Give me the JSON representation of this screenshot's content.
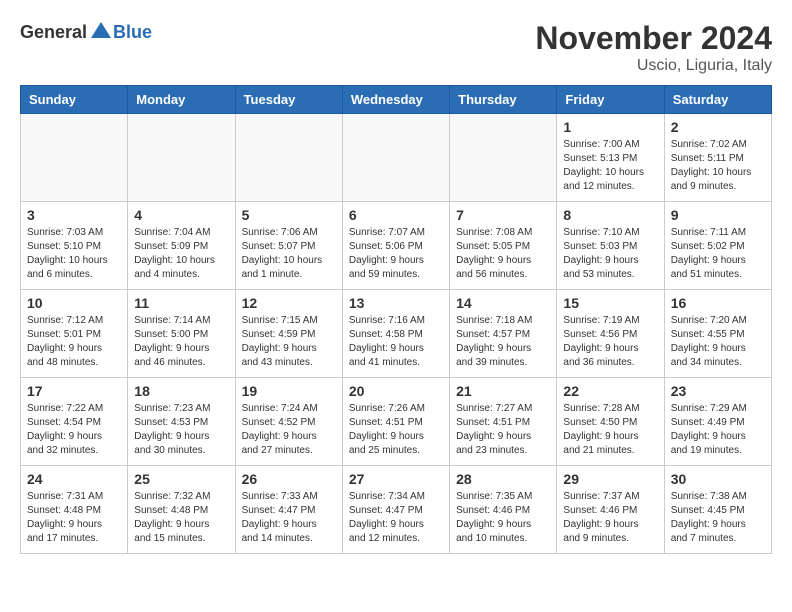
{
  "header": {
    "logo_general": "General",
    "logo_blue": "Blue",
    "month_year": "November 2024",
    "location": "Uscio, Liguria, Italy"
  },
  "weekdays": [
    "Sunday",
    "Monday",
    "Tuesday",
    "Wednesday",
    "Thursday",
    "Friday",
    "Saturday"
  ],
  "weeks": [
    [
      {
        "day": "",
        "info": ""
      },
      {
        "day": "",
        "info": ""
      },
      {
        "day": "",
        "info": ""
      },
      {
        "day": "",
        "info": ""
      },
      {
        "day": "",
        "info": ""
      },
      {
        "day": "1",
        "info": "Sunrise: 7:00 AM\nSunset: 5:13 PM\nDaylight: 10 hours\nand 12 minutes."
      },
      {
        "day": "2",
        "info": "Sunrise: 7:02 AM\nSunset: 5:11 PM\nDaylight: 10 hours\nand 9 minutes."
      }
    ],
    [
      {
        "day": "3",
        "info": "Sunrise: 7:03 AM\nSunset: 5:10 PM\nDaylight: 10 hours\nand 6 minutes."
      },
      {
        "day": "4",
        "info": "Sunrise: 7:04 AM\nSunset: 5:09 PM\nDaylight: 10 hours\nand 4 minutes."
      },
      {
        "day": "5",
        "info": "Sunrise: 7:06 AM\nSunset: 5:07 PM\nDaylight: 10 hours\nand 1 minute."
      },
      {
        "day": "6",
        "info": "Sunrise: 7:07 AM\nSunset: 5:06 PM\nDaylight: 9 hours\nand 59 minutes."
      },
      {
        "day": "7",
        "info": "Sunrise: 7:08 AM\nSunset: 5:05 PM\nDaylight: 9 hours\nand 56 minutes."
      },
      {
        "day": "8",
        "info": "Sunrise: 7:10 AM\nSunset: 5:03 PM\nDaylight: 9 hours\nand 53 minutes."
      },
      {
        "day": "9",
        "info": "Sunrise: 7:11 AM\nSunset: 5:02 PM\nDaylight: 9 hours\nand 51 minutes."
      }
    ],
    [
      {
        "day": "10",
        "info": "Sunrise: 7:12 AM\nSunset: 5:01 PM\nDaylight: 9 hours\nand 48 minutes."
      },
      {
        "day": "11",
        "info": "Sunrise: 7:14 AM\nSunset: 5:00 PM\nDaylight: 9 hours\nand 46 minutes."
      },
      {
        "day": "12",
        "info": "Sunrise: 7:15 AM\nSunset: 4:59 PM\nDaylight: 9 hours\nand 43 minutes."
      },
      {
        "day": "13",
        "info": "Sunrise: 7:16 AM\nSunset: 4:58 PM\nDaylight: 9 hours\nand 41 minutes."
      },
      {
        "day": "14",
        "info": "Sunrise: 7:18 AM\nSunset: 4:57 PM\nDaylight: 9 hours\nand 39 minutes."
      },
      {
        "day": "15",
        "info": "Sunrise: 7:19 AM\nSunset: 4:56 PM\nDaylight: 9 hours\nand 36 minutes."
      },
      {
        "day": "16",
        "info": "Sunrise: 7:20 AM\nSunset: 4:55 PM\nDaylight: 9 hours\nand 34 minutes."
      }
    ],
    [
      {
        "day": "17",
        "info": "Sunrise: 7:22 AM\nSunset: 4:54 PM\nDaylight: 9 hours\nand 32 minutes."
      },
      {
        "day": "18",
        "info": "Sunrise: 7:23 AM\nSunset: 4:53 PM\nDaylight: 9 hours\nand 30 minutes."
      },
      {
        "day": "19",
        "info": "Sunrise: 7:24 AM\nSunset: 4:52 PM\nDaylight: 9 hours\nand 27 minutes."
      },
      {
        "day": "20",
        "info": "Sunrise: 7:26 AM\nSunset: 4:51 PM\nDaylight: 9 hours\nand 25 minutes."
      },
      {
        "day": "21",
        "info": "Sunrise: 7:27 AM\nSunset: 4:51 PM\nDaylight: 9 hours\nand 23 minutes."
      },
      {
        "day": "22",
        "info": "Sunrise: 7:28 AM\nSunset: 4:50 PM\nDaylight: 9 hours\nand 21 minutes."
      },
      {
        "day": "23",
        "info": "Sunrise: 7:29 AM\nSunset: 4:49 PM\nDaylight: 9 hours\nand 19 minutes."
      }
    ],
    [
      {
        "day": "24",
        "info": "Sunrise: 7:31 AM\nSunset: 4:48 PM\nDaylight: 9 hours\nand 17 minutes."
      },
      {
        "day": "25",
        "info": "Sunrise: 7:32 AM\nSunset: 4:48 PM\nDaylight: 9 hours\nand 15 minutes."
      },
      {
        "day": "26",
        "info": "Sunrise: 7:33 AM\nSunset: 4:47 PM\nDaylight: 9 hours\nand 14 minutes."
      },
      {
        "day": "27",
        "info": "Sunrise: 7:34 AM\nSunset: 4:47 PM\nDaylight: 9 hours\nand 12 minutes."
      },
      {
        "day": "28",
        "info": "Sunrise: 7:35 AM\nSunset: 4:46 PM\nDaylight: 9 hours\nand 10 minutes."
      },
      {
        "day": "29",
        "info": "Sunrise: 7:37 AM\nSunset: 4:46 PM\nDaylight: 9 hours\nand 9 minutes."
      },
      {
        "day": "30",
        "info": "Sunrise: 7:38 AM\nSunset: 4:45 PM\nDaylight: 9 hours\nand 7 minutes."
      }
    ]
  ]
}
